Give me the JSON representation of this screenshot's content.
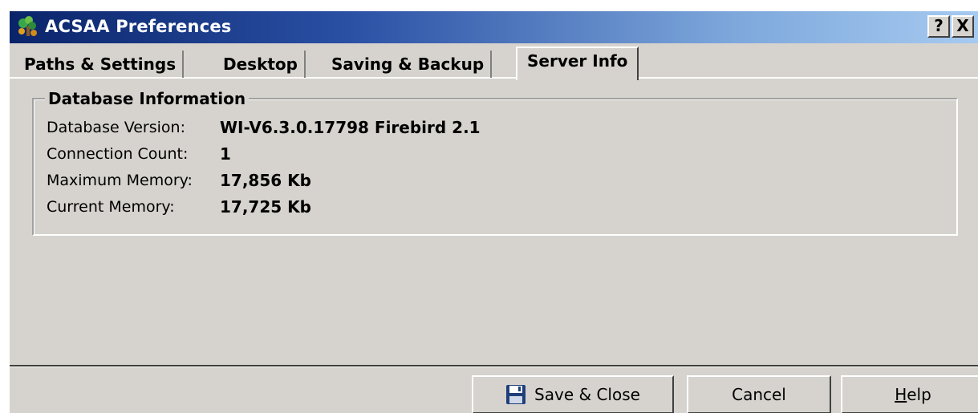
{
  "window": {
    "title": "ACSAA Preferences",
    "caption_help": "?",
    "caption_close": "X"
  },
  "tabs": [
    {
      "label": "Paths & Settings",
      "active": false
    },
    {
      "label": "Desktop",
      "active": false
    },
    {
      "label": "Saving & Backup",
      "active": false
    },
    {
      "label": "Server Info",
      "active": true
    }
  ],
  "database_info": {
    "group_title": "Database Information",
    "rows": [
      {
        "label": "Database Version:",
        "value": "WI-V6.3.0.17798 Firebird 2.1"
      },
      {
        "label": "Connection Count:",
        "value": "1"
      },
      {
        "label": "Maximum Memory:",
        "value": "17,856 Kb"
      },
      {
        "label": "Current Memory:",
        "value": "17,725 Kb"
      }
    ]
  },
  "buttons": {
    "save_close": "Save & Close",
    "cancel": "Cancel",
    "help_first": "H",
    "help_rest": "elp"
  },
  "colors": {
    "titlebar_start": "#0a246a",
    "titlebar_end": "#a6caf0",
    "face": "#d6d3ce"
  }
}
